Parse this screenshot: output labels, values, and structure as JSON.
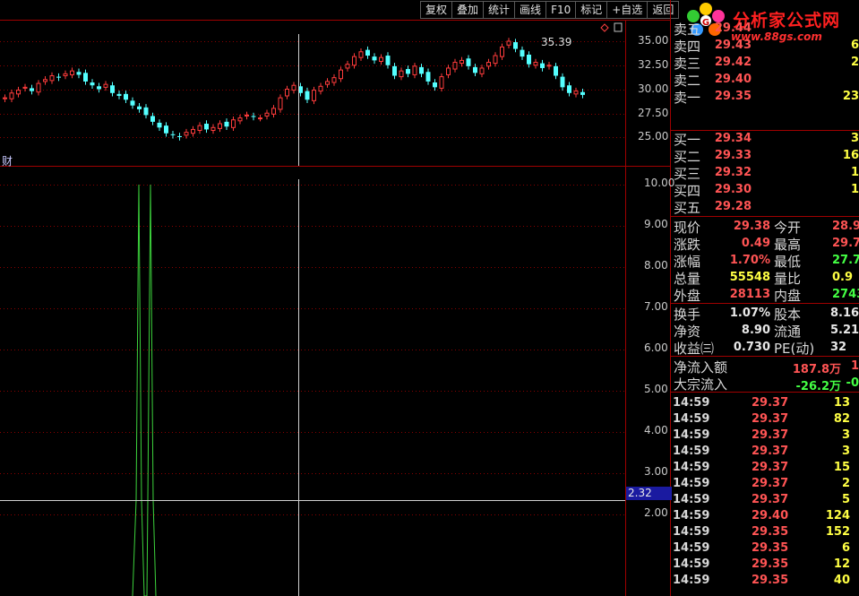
{
  "toolbar": {
    "items": [
      "复权",
      "叠加",
      "统计",
      "画线",
      "F10",
      "标记",
      "+自选",
      "返回"
    ]
  },
  "logo": {
    "title": "分析家公式网",
    "url": "www.88gs.com"
  },
  "price_chart": {
    "high_marker": "35.39",
    "y_ticks": [
      "35.00",
      "32.50",
      "30.00",
      "27.50",
      "25.00"
    ],
    "tag": "财",
    "colors": {
      "up": "#ff3c3c",
      "down": "#54ffff"
    }
  },
  "indicator_chart": {
    "y_ticks": [
      "10.00",
      "9.00",
      "8.00",
      "7.00",
      "6.00",
      "5.00",
      "4.00",
      "3.00",
      "2.00"
    ],
    "cursor_value": "2.32",
    "line_color": "#3cd23c"
  },
  "order_book": {
    "asks": [
      {
        "label": "卖五",
        "price": "29.44",
        "vol": ""
      },
      {
        "label": "卖四",
        "price": "29.43",
        "vol": "6"
      },
      {
        "label": "卖三",
        "price": "29.42",
        "vol": "2"
      },
      {
        "label": "卖二",
        "price": "29.40",
        "vol": ""
      },
      {
        "label": "卖一",
        "price": "29.35",
        "vol": "23"
      }
    ],
    "bids": [
      {
        "label": "买一",
        "price": "29.34",
        "vol": "3"
      },
      {
        "label": "买二",
        "price": "29.33",
        "vol": "16"
      },
      {
        "label": "买三",
        "price": "29.32",
        "vol": "1"
      },
      {
        "label": "买四",
        "price": "29.30",
        "vol": "1"
      },
      {
        "label": "买五",
        "price": "29.28",
        "vol": ""
      }
    ]
  },
  "quote": {
    "rows": [
      {
        "l1": "现价",
        "v1": "29.38",
        "c1": "red",
        "l2": "今开",
        "v2": "28.9",
        "c2": "red"
      },
      {
        "l1": "涨跌",
        "v1": "0.49",
        "c1": "red",
        "l2": "最高",
        "v2": "29.7",
        "c2": "red"
      },
      {
        "l1": "涨幅",
        "v1": "1.70%",
        "c1": "red",
        "l2": "最低",
        "v2": "27.7",
        "c2": "green"
      },
      {
        "l1": "总量",
        "v1": "55548",
        "c1": "yellow",
        "l2": "量比",
        "v2": "0.9",
        "c2": "yellow"
      },
      {
        "l1": "外盘",
        "v1": "28113",
        "c1": "red",
        "l2": "内盘",
        "v2": "2743",
        "c2": "green"
      }
    ]
  },
  "finance": {
    "rows": [
      {
        "l1": "换手",
        "v1": "1.07%",
        "l2": "股本",
        "v2": "8.16"
      },
      {
        "l1": "净资",
        "v1": "8.90",
        "l2": "流通",
        "v2": "5.21"
      },
      {
        "l1": "收益㈢",
        "v1": "0.730",
        "l2": "PE(动)",
        "v2": "32"
      }
    ]
  },
  "flow": {
    "rows": [
      {
        "label": "净流入额",
        "value": "187.8万",
        "c": "red",
        "extra": "1",
        "ce": "red"
      },
      {
        "label": "大宗流入",
        "value": "-26.2万",
        "c": "green",
        "extra": "-0",
        "ce": "green"
      }
    ]
  },
  "ticks": [
    {
      "time": "14:59",
      "price": "29.37",
      "vol": "13",
      "c": "red"
    },
    {
      "time": "14:59",
      "price": "29.37",
      "vol": "82",
      "c": "red"
    },
    {
      "time": "14:59",
      "price": "29.37",
      "vol": "3",
      "c": "red"
    },
    {
      "time": "14:59",
      "price": "29.37",
      "vol": "3",
      "c": "red"
    },
    {
      "time": "14:59",
      "price": "29.37",
      "vol": "15",
      "c": "red"
    },
    {
      "time": "14:59",
      "price": "29.37",
      "vol": "2",
      "c": "red"
    },
    {
      "time": "14:59",
      "price": "29.37",
      "vol": "5",
      "c": "red"
    },
    {
      "time": "14:59",
      "price": "29.40",
      "vol": "124",
      "c": "red"
    },
    {
      "time": "14:59",
      "price": "29.35",
      "vol": "152",
      "c": "red"
    },
    {
      "time": "14:59",
      "price": "29.35",
      "vol": "6",
      "c": "red"
    },
    {
      "time": "14:59",
      "price": "29.35",
      "vol": "12",
      "c": "red"
    },
    {
      "time": "14:59",
      "price": "29.35",
      "vol": "40",
      "c": "red"
    }
  ]
}
